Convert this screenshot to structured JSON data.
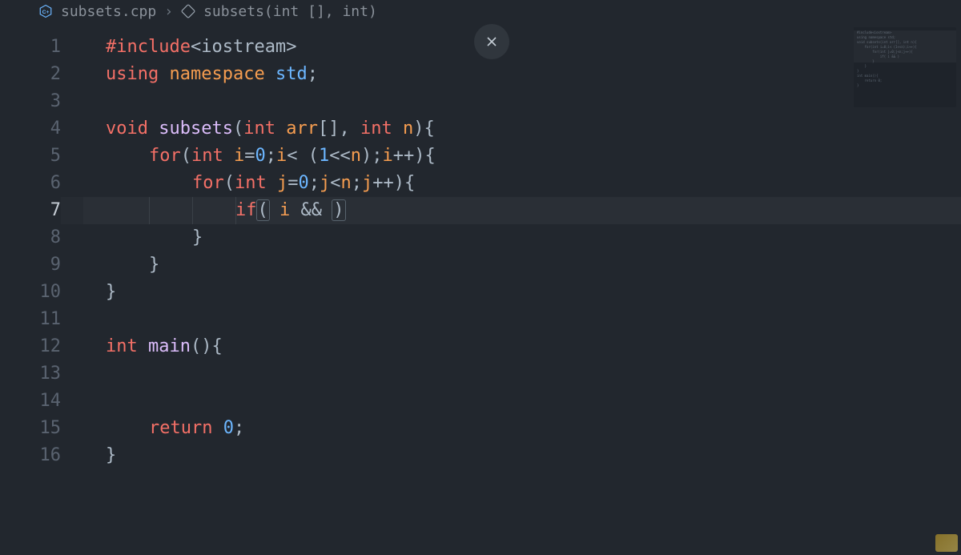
{
  "breadcrumb": {
    "file_icon": "cpp-icon",
    "file_name": "subsets.cpp",
    "chevron": "›",
    "symbol_icon": "symbol-method-icon",
    "symbol_name": "subsets(int [], int)"
  },
  "close_button": {
    "title": "Close"
  },
  "editor": {
    "active_line": 7,
    "lines": [
      {
        "num": 1,
        "tokens": [
          [
            "preproc",
            "#include"
          ],
          [
            "punct",
            "<"
          ],
          [
            "plain",
            "iostream"
          ],
          [
            "punct",
            ">"
          ]
        ]
      },
      {
        "num": 2,
        "tokens": [
          [
            "using",
            "using"
          ],
          [
            "plain",
            " "
          ],
          [
            "namespace",
            "namespace"
          ],
          [
            "plain",
            " "
          ],
          [
            "std",
            "std"
          ],
          [
            "punct",
            ";"
          ]
        ]
      },
      {
        "num": 3,
        "tokens": []
      },
      {
        "num": 4,
        "tokens": [
          [
            "type",
            "void"
          ],
          [
            "plain",
            " "
          ],
          [
            "func",
            "subsets"
          ],
          [
            "punct",
            "("
          ],
          [
            "type",
            "int"
          ],
          [
            "plain",
            " "
          ],
          [
            "param",
            "arr"
          ],
          [
            "punct",
            "[]"
          ],
          [
            "punct",
            ","
          ],
          [
            "plain",
            " "
          ],
          [
            "type",
            "int"
          ],
          [
            "plain",
            " "
          ],
          [
            "param",
            "n"
          ],
          [
            "punct",
            ")"
          ],
          [
            "punct",
            "{"
          ]
        ]
      },
      {
        "num": 5,
        "indent": 1,
        "tokens": [
          [
            "keyword",
            "for"
          ],
          [
            "punct",
            "("
          ],
          [
            "type",
            "int"
          ],
          [
            "plain",
            " "
          ],
          [
            "param",
            "i"
          ],
          [
            "op",
            "="
          ],
          [
            "number",
            "0"
          ],
          [
            "punct",
            ";"
          ],
          [
            "param",
            "i"
          ],
          [
            "op",
            "<"
          ],
          [
            "plain",
            " "
          ],
          [
            "punct",
            "("
          ],
          [
            "number",
            "1"
          ],
          [
            "op",
            "<<"
          ],
          [
            "param",
            "n"
          ],
          [
            "punct",
            ")"
          ],
          [
            "punct",
            ";"
          ],
          [
            "param",
            "i"
          ],
          [
            "op",
            "++"
          ],
          [
            "punct",
            ")"
          ],
          [
            "punct",
            "{"
          ]
        ]
      },
      {
        "num": 6,
        "indent": 2,
        "tokens": [
          [
            "keyword",
            "for"
          ],
          [
            "punct",
            "("
          ],
          [
            "type",
            "int"
          ],
          [
            "plain",
            " "
          ],
          [
            "param",
            "j"
          ],
          [
            "op",
            "="
          ],
          [
            "number",
            "0"
          ],
          [
            "punct",
            ";"
          ],
          [
            "param",
            "j"
          ],
          [
            "op",
            "<"
          ],
          [
            "param",
            "n"
          ],
          [
            "punct",
            ";"
          ],
          [
            "param",
            "j"
          ],
          [
            "op",
            "++"
          ],
          [
            "punct",
            ")"
          ],
          [
            "punct",
            "{"
          ]
        ]
      },
      {
        "num": 7,
        "indent": 3,
        "guides": [
          1,
          2,
          3
        ],
        "hl": true,
        "tokens": [
          [
            "keyword",
            "if"
          ],
          [
            "bracket",
            "("
          ],
          [
            "plain",
            " "
          ],
          [
            "param",
            "i"
          ],
          [
            "plain",
            " "
          ],
          [
            "op",
            "&&"
          ],
          [
            "plain",
            " "
          ],
          [
            "bracket",
            ")"
          ]
        ]
      },
      {
        "num": 8,
        "indent": 2,
        "tokens": [
          [
            "punct",
            "}"
          ]
        ]
      },
      {
        "num": 9,
        "indent": 1,
        "tokens": [
          [
            "punct",
            "}"
          ]
        ]
      },
      {
        "num": 10,
        "tokens": [
          [
            "punct",
            "}"
          ]
        ]
      },
      {
        "num": 11,
        "tokens": []
      },
      {
        "num": 12,
        "tokens": [
          [
            "type",
            "int"
          ],
          [
            "plain",
            " "
          ],
          [
            "func",
            "main"
          ],
          [
            "punct",
            "()"
          ],
          [
            "punct",
            "{"
          ]
        ]
      },
      {
        "num": 13,
        "tokens": []
      },
      {
        "num": 14,
        "tokens": []
      },
      {
        "num": 15,
        "indent": 1,
        "tokens": [
          [
            "keyword",
            "return"
          ],
          [
            "plain",
            " "
          ],
          [
            "number",
            "0"
          ],
          [
            "punct",
            ";"
          ]
        ]
      },
      {
        "num": 16,
        "tokens": [
          [
            "punct",
            "}"
          ]
        ]
      }
    ]
  },
  "minimap_lines": [
    "#include<iostream>",
    "using namespace std;",
    "",
    "void subsets(int arr[], int n){",
    "    for(int i=0;i< (1<<n);i++){",
    "        for(int j=0;j<n;j++){",
    "            if( i && )",
    "        }",
    "    }",
    "}",
    "",
    "int main(){",
    "",
    "",
    "    return 0;",
    "}"
  ]
}
